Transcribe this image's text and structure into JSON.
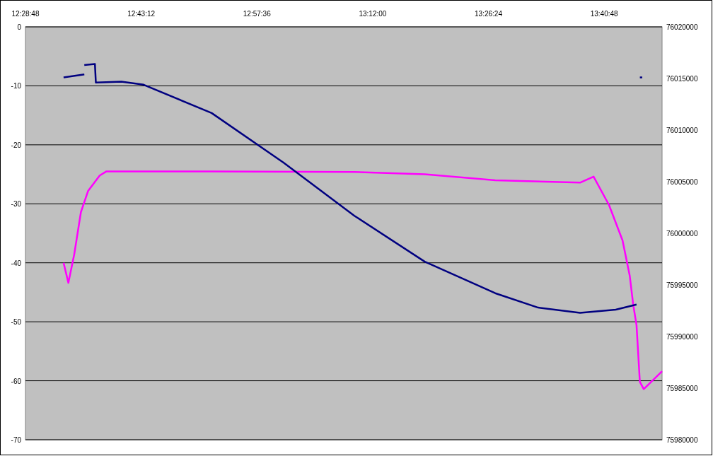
{
  "chart_data": {
    "type": "line",
    "grid": true,
    "xlim": [
      12.48,
      13.8
    ],
    "xticks": [
      {
        "value": 12.48,
        "label": "12:28:48"
      },
      {
        "value": 12.72,
        "label": "12:43:12"
      },
      {
        "value": 12.96,
        "label": "12:57:36"
      },
      {
        "value": 13.2,
        "label": "13:12:00"
      },
      {
        "value": 13.44,
        "label": "13:26:24"
      },
      {
        "value": 13.68,
        "label": "13:40:48"
      }
    ],
    "ylim": [
      -70,
      0
    ],
    "yticks": [
      0,
      -10,
      -20,
      -30,
      -40,
      -50,
      -60,
      -70
    ],
    "y2lim": [
      75980000,
      76020000
    ],
    "y2ticks": [
      76020000,
      76015000,
      76010000,
      76005000,
      76000000,
      75995000,
      75990000,
      75985000,
      75980000
    ],
    "series": [
      {
        "color": "#ff00ff",
        "x": [
          12.559,
          12.569,
          12.581,
          12.595,
          12.61,
          12.634,
          12.648,
          12.866,
          13.162,
          13.308,
          13.454,
          13.63,
          13.658,
          13.69,
          13.718,
          13.733,
          13.74,
          13.747,
          13.754,
          13.762,
          13.8
        ],
        "values": [
          -40,
          -43.4,
          -38.6,
          -31.4,
          -27.8,
          -25.2,
          -24.5,
          -24.5,
          -24.6,
          -25,
          -26,
          -26.4,
          -25.4,
          -30.2,
          -36.2,
          -42.2,
          -47,
          -50.6,
          -60.2,
          -61.4,
          -58.4
        ]
      },
      {
        "color": "#000080",
        "axis": "y2",
        "x": [
          12.559,
          12.602
        ],
        "values": [
          76015100,
          76015400
        ]
      },
      {
        "color": "#000080",
        "axis": "y2",
        "x": [
          12.602,
          12.624,
          12.626,
          12.679,
          12.725,
          12.866,
          13.015,
          13.162,
          13.308,
          13.454,
          13.543,
          13.63,
          13.704,
          13.747
        ],
        "values": [
          76016300,
          76016400,
          76014600,
          76014700,
          76014400,
          76011650,
          76006850,
          76001700,
          75997250,
          75994200,
          75992800,
          75992300,
          75992600,
          75993100
        ]
      },
      {
        "color": "#000080",
        "axis": "y2",
        "x": [
          13.754,
          13.759
        ],
        "values": [
          76015100,
          76015100
        ]
      }
    ]
  }
}
